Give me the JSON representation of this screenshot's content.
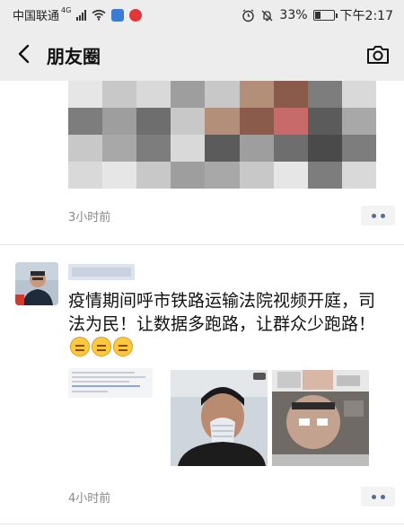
{
  "status_bar": {
    "carrier": "中国联通",
    "network": "4G",
    "battery": "33%",
    "battery_level": 0.33,
    "time": "下午2:17"
  },
  "navbar": {
    "title": "朋友圈",
    "back_icon": "chevron-left-icon",
    "camera_icon": "camera-icon"
  },
  "feed": {
    "posts": [
      {
        "time": "3小时前"
      },
      {
        "text": "疫情期间呼市铁路运输法院视频开庭，司法为民！让数据多跑路，让群众少跑路！",
        "emoji_count": 3,
        "time": "4小时前"
      }
    ]
  },
  "colors": {
    "bar_bg": "#ededed",
    "link_blue": "#576b95",
    "meta_gray": "#888888"
  }
}
